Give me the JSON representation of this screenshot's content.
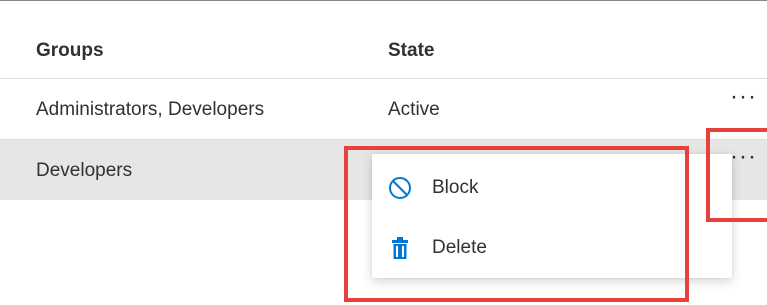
{
  "table": {
    "columns": {
      "groups": "Groups",
      "state": "State"
    },
    "rows": [
      {
        "groups": "Administrators, Developers",
        "state": "Active",
        "more": "···"
      },
      {
        "groups": "Developers",
        "state": "",
        "more": "···"
      }
    ]
  },
  "context_menu": {
    "items": [
      {
        "label": "Block",
        "icon": "block-icon"
      },
      {
        "label": "Delete",
        "icon": "trash-icon"
      }
    ]
  },
  "colors": {
    "highlight": "#e8403a",
    "icon_blue": "#0078d4",
    "selected_row": "#e6e6e6"
  }
}
